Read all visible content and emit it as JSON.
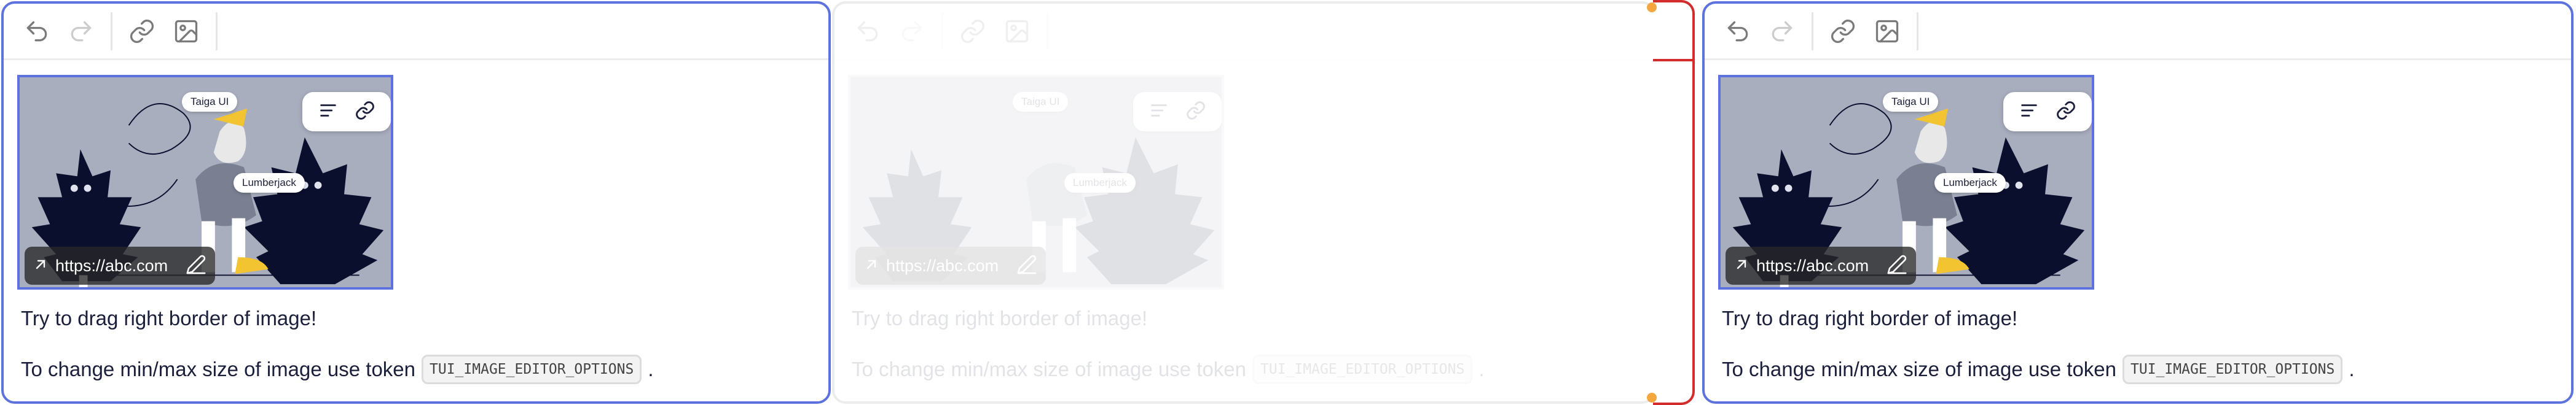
{
  "editors": [
    {
      "state": "focused",
      "image": {
        "tag_taiga": "Taiga UI",
        "tag_lumberjack": "Lumberjack",
        "link_url": "https://abc.com"
      },
      "paragraph1": "Try to drag right border of image!",
      "paragraph2_prefix": "To change min/max size of image use token",
      "token": "TUI_IMAGE_EDITOR_OPTIONS",
      "paragraph2_suffix": "."
    },
    {
      "state": "ghost",
      "image": {
        "tag_taiga": "Taiga UI",
        "tag_lumberjack": "Lumberjack",
        "link_url": "https://abc.com"
      },
      "paragraph1": "Try to drag right border of image!",
      "paragraph2_prefix": "To change min/max size of image use token",
      "token": "TUI_IMAGE_EDITOR_OPTIONS",
      "paragraph2_suffix": "."
    },
    {
      "state": "focused",
      "image": {
        "tag_taiga": "Taiga UI",
        "tag_lumberjack": "Lumberjack",
        "link_url": "https://abc.com"
      },
      "paragraph1": "Try to drag right border of image!",
      "paragraph2_prefix": "To change min/max size of image use token",
      "token": "TUI_IMAGE_EDITOR_OPTIONS",
      "paragraph2_suffix": "."
    }
  ],
  "toolbar": {
    "icons": [
      "undo-icon",
      "redo-icon",
      "link-icon",
      "image-icon"
    ]
  },
  "colors": {
    "focus_border": "#5d72de",
    "drag_handle": "#d22c2c",
    "image_bg": "#a9aebf",
    "ink": "#1b1f3b"
  }
}
